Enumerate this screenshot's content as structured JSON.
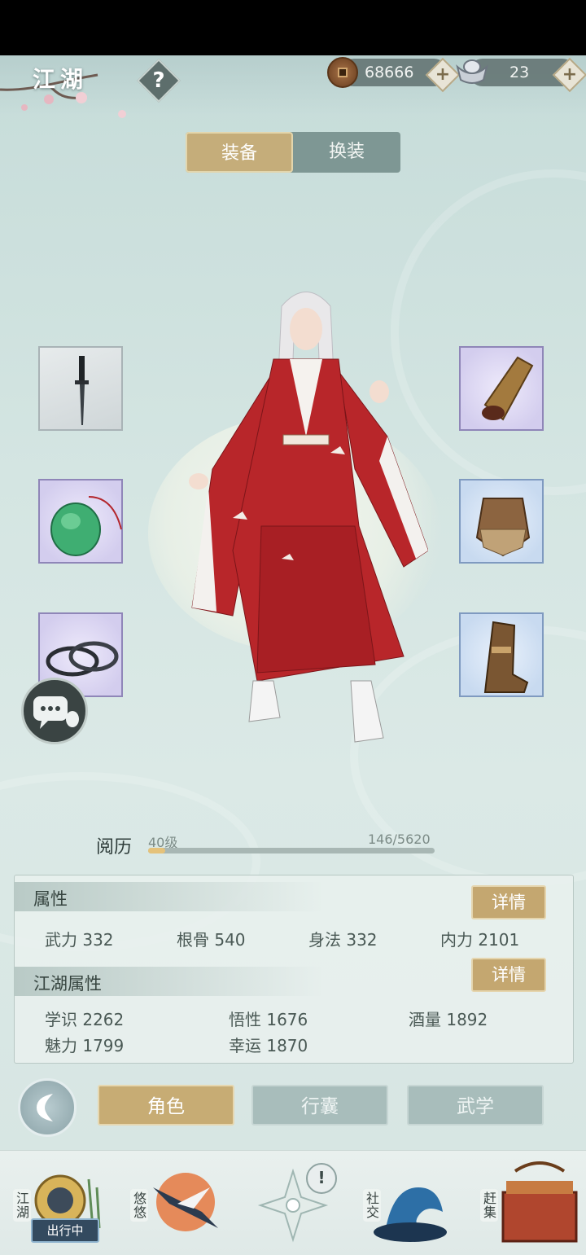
{
  "header": {
    "title": "江湖",
    "help_label": "?",
    "copper_amount": "68666",
    "silver_amount": "23",
    "plus_label": "+"
  },
  "tabs": {
    "equipment": "装备",
    "outfit": "换装"
  },
  "experience": {
    "label": "阅历",
    "level": "40级",
    "progress": "146/5620",
    "current": 146,
    "max": 5620
  },
  "attributes": {
    "title": "属性",
    "detail_label": "详情",
    "items": [
      {
        "name": "武力",
        "value": "332"
      },
      {
        "name": "根骨",
        "value": "540"
      },
      {
        "name": "身法",
        "value": "332"
      },
      {
        "name": "内力",
        "value": "2101"
      }
    ]
  },
  "jianghu_attributes": {
    "title": "江湖属性",
    "detail_label": "详情",
    "items": [
      {
        "name": "学识",
        "value": "2262"
      },
      {
        "name": "悟性",
        "value": "1676"
      },
      {
        "name": "酒量",
        "value": "1892"
      },
      {
        "name": "魅力",
        "value": "1799"
      },
      {
        "name": "幸运",
        "value": "1870"
      }
    ]
  },
  "menu": {
    "character": "角色",
    "bag": "行囊",
    "martial": "武学"
  },
  "nav": {
    "jianghu": "江湖",
    "status": "出行中",
    "youyou": "悠悠",
    "alert": "!",
    "social": "社交",
    "market": "赶集"
  },
  "colors": {
    "accent_gold": "#c5ad7a",
    "panel_teal": "#7e9794",
    "robe_red": "#b8262a"
  }
}
